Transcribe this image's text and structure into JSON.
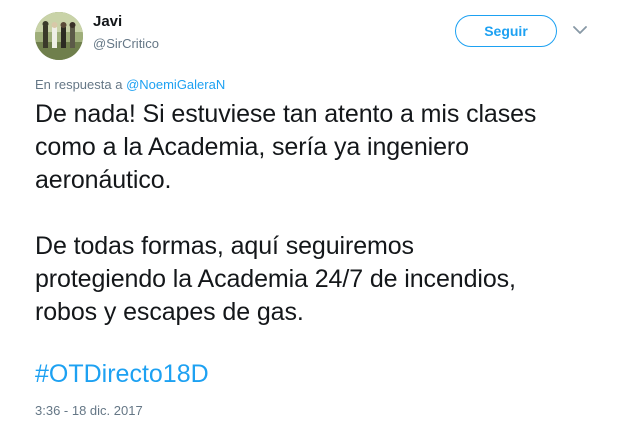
{
  "tweet": {
    "author": {
      "display_name": "Javi",
      "handle": "@SirCritico"
    },
    "follow_label": "Seguir",
    "reply_context": {
      "prefix": "En respuesta a ",
      "mention": "@NoemiGaleraN"
    },
    "text_lines": {
      "p1_l1": "De nada! Si estuviese tan atento a mis clases",
      "p1_l2": "como a la Academia, sería ya ingeniero",
      "p1_l3": "aeronáutico.",
      "p2_l1": "De todas formas, aquí seguiremos",
      "p2_l2": "protegiendo la Academia 24/7 de incendios,",
      "p2_l3": "robos y escapes de gas."
    },
    "hashtag": "#OTDirecto18D",
    "timestamp": "3:36 - 18 dic. 2017"
  },
  "icons": {
    "avatar": "avatar-photo",
    "caret": "chevron-down-icon"
  },
  "colors": {
    "link_blue": "#1da1f2",
    "secondary_text": "#657786",
    "primary_text": "#14171a"
  }
}
